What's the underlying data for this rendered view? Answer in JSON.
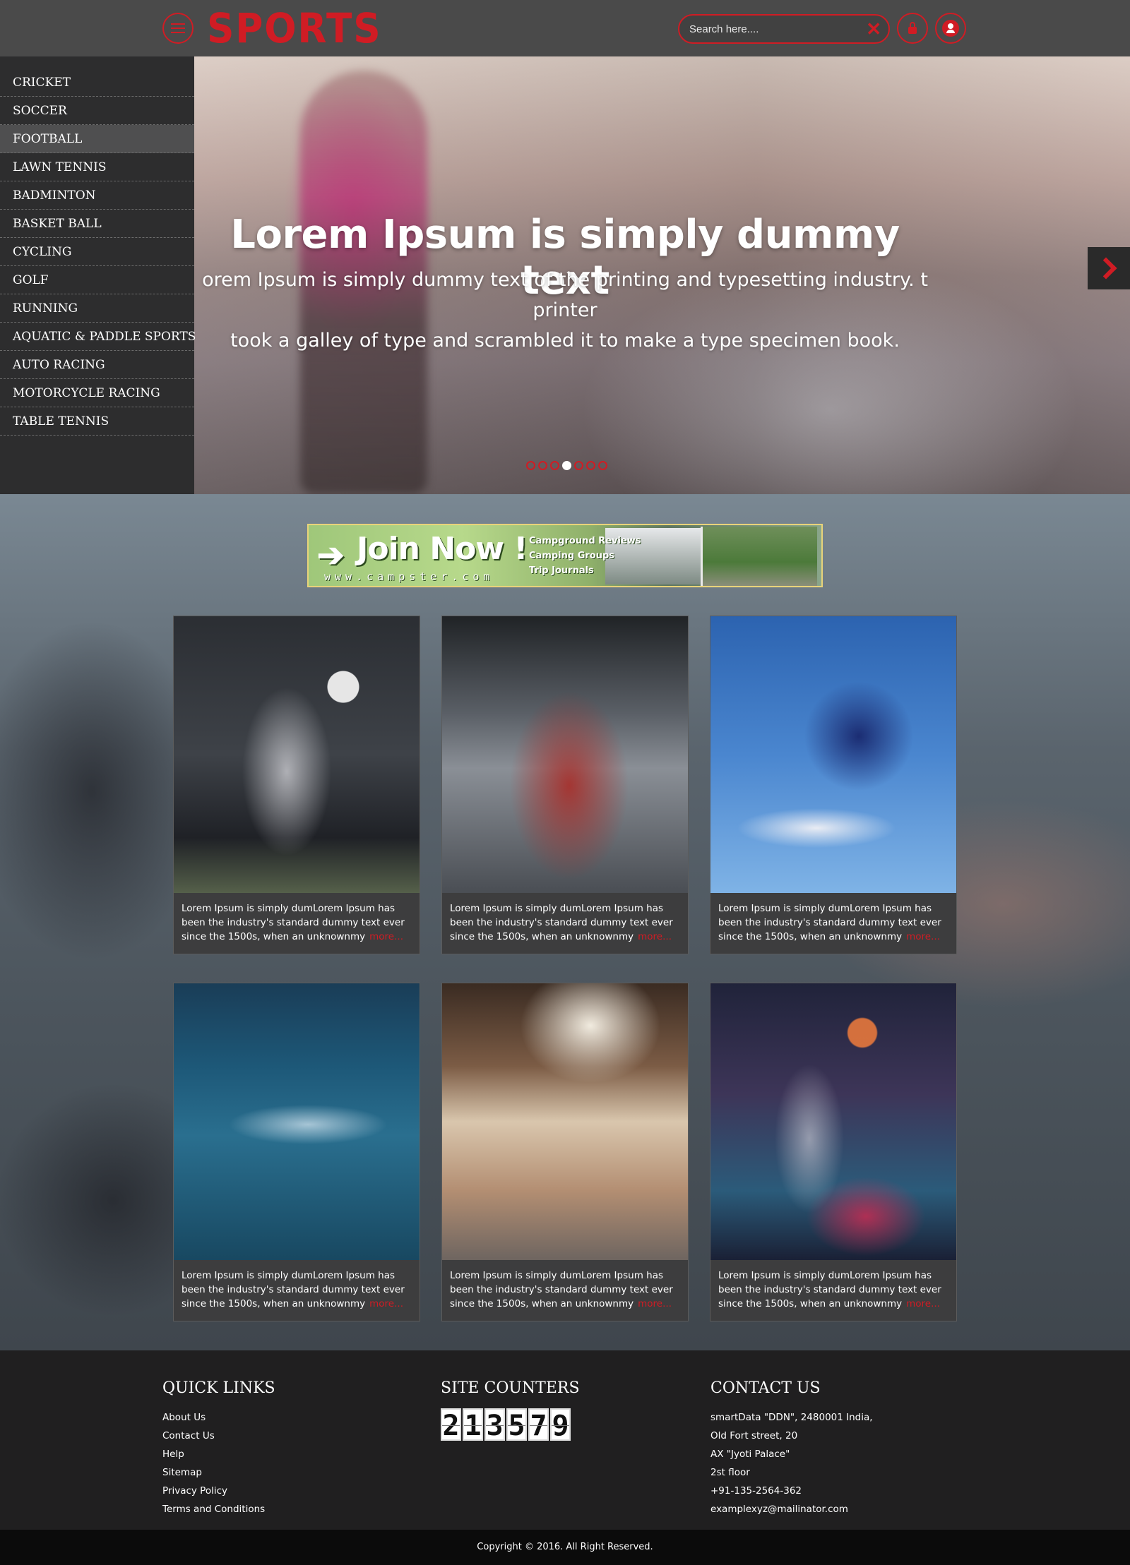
{
  "header": {
    "logo": "SPORTS",
    "search_placeholder": "Search here....",
    "search_clear": "✕"
  },
  "sidebar": {
    "items": [
      {
        "label": "CRICKET"
      },
      {
        "label": "SOCCER"
      },
      {
        "label": "FOOTBALL"
      },
      {
        "label": "LAWN TENNIS"
      },
      {
        "label": "BADMINTON"
      },
      {
        "label": "BASKET BALL"
      },
      {
        "label": "CYCLING"
      },
      {
        "label": "GOLF"
      },
      {
        "label": "RUNNING"
      },
      {
        "label": "AQUATIC & PADDLE SPORTS"
      },
      {
        "label": "AUTO RACING"
      },
      {
        "label": "MOTORCYCLE RACING"
      },
      {
        "label": "TABLE TENNIS"
      }
    ],
    "active_index": 2
  },
  "hero": {
    "title": "Lorem Ipsum is simply dummy text",
    "subtitle_line1": "orem Ipsum is simply dummy text of the printing and typesetting industry. t printer",
    "subtitle_line2": "took a galley of type and scrambled it to make a type specimen book.",
    "slide_count": 7,
    "active_slide": 4
  },
  "ad": {
    "headline": "Join Now !",
    "url": "www.campster.com",
    "line1": "Campground Reviews",
    "line2": "Camping Groups",
    "line3": "Trip Journals"
  },
  "cards": [
    {
      "image": "soccer-player-kick",
      "text": "Lorem Ipsum is simply dumLorem Ipsum has been the industry's standard dummy text ever since the 1500s, when an unknownmy",
      "more": "more..."
    },
    {
      "image": "motocross-rider",
      "text": "Lorem Ipsum is simply dumLorem Ipsum has been the industry's standard dummy text ever since the 1500s, when an unknownmy",
      "more": "more..."
    },
    {
      "image": "snowboarder-jump",
      "text": "Lorem Ipsum is simply dumLorem Ipsum has been the industry's standard dummy text ever since the 1500s, when an unknownmy",
      "more": "more..."
    },
    {
      "image": "underwater-swimmer",
      "text": "Lorem Ipsum is simply dumLorem Ipsum has been the industry's standard dummy text ever since the 1500s, when an unknownmy",
      "more": "more..."
    },
    {
      "image": "rock-climber",
      "text": "Lorem Ipsum is simply dumLorem Ipsum has been the industry's standard dummy text ever since the 1500s, when an unknownmy",
      "more": "more..."
    },
    {
      "image": "basketball-player",
      "text": "Lorem Ipsum is simply dumLorem Ipsum has been the industry's standard dummy text ever since the 1500s, when an unknownmy",
      "more": "more..."
    }
  ],
  "footer": {
    "quick_links": {
      "heading": "QUICK LINKS",
      "links": [
        "About Us",
        "Contact Us",
        "Help",
        "Sitemap",
        "Privacy Policy",
        "Terms and Conditions"
      ]
    },
    "site_counters": {
      "heading": "SITE COUNTERS",
      "digits": [
        "2",
        "1",
        "3",
        "5",
        "7",
        "9"
      ]
    },
    "contact": {
      "heading": "CONTACT US",
      "lines": [
        "smartData \"DDN\", 2480001 India,",
        "Old Fort street, 20",
        "AX \"Jyoti Palace\"",
        "2st floor",
        "+91-135-2564-362",
        "examplexyz@mailinator.com"
      ]
    },
    "copyright": "Copyright © 2016. All Right Reserved."
  },
  "colors": {
    "accent": "#d01c24",
    "header_bg": "#4a4a4a",
    "sidebar_bg": "#2d2d2e",
    "footer_bg": "#201f20",
    "copyright_bg": "#0b0b0b"
  }
}
